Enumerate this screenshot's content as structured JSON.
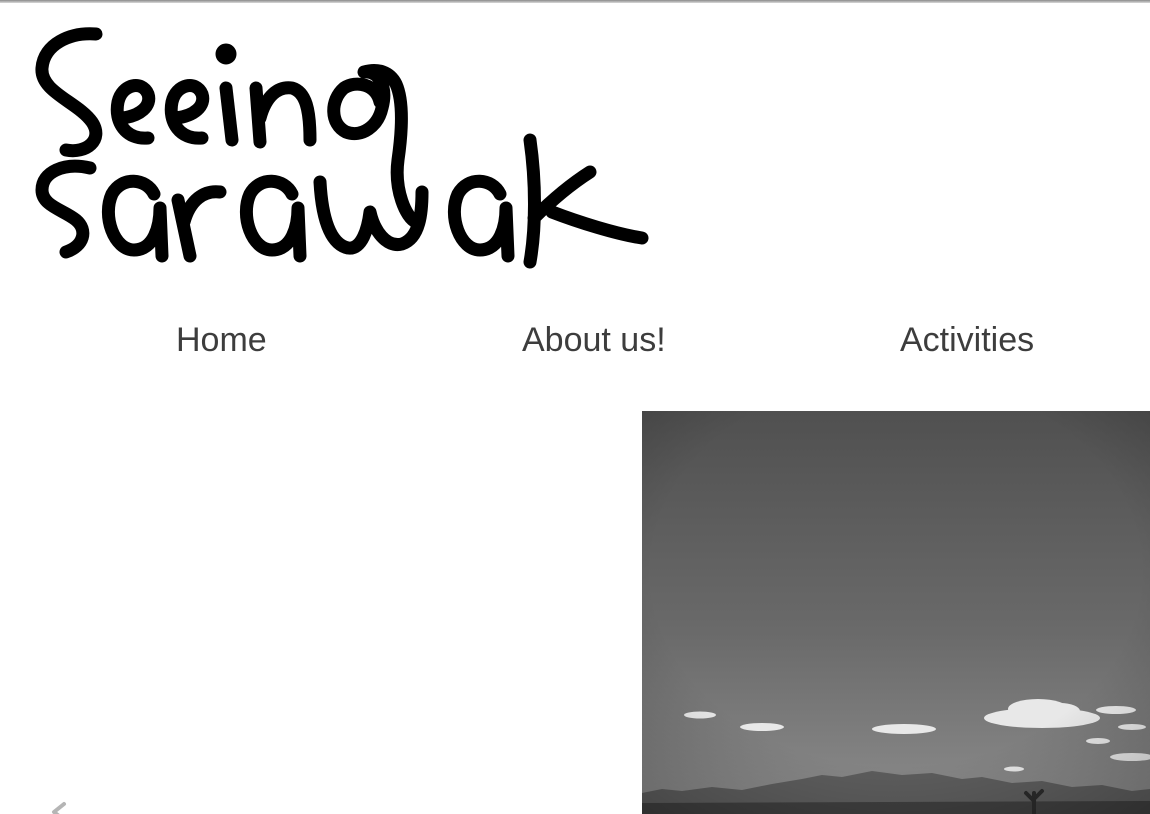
{
  "site": {
    "logo_text": "Seeing Sarawak"
  },
  "nav": {
    "items": [
      {
        "label": "Home"
      },
      {
        "label": "About us!"
      },
      {
        "label": "Activities"
      }
    ]
  },
  "hero": {
    "image_icon": "landscape-photo",
    "style": "grayscale"
  },
  "slider": {
    "prev_icon": "chevron-left-icon"
  },
  "colors": {
    "nav_text": "#3d3d3d",
    "logo_ink": "#000000",
    "background": "#ffffff"
  }
}
